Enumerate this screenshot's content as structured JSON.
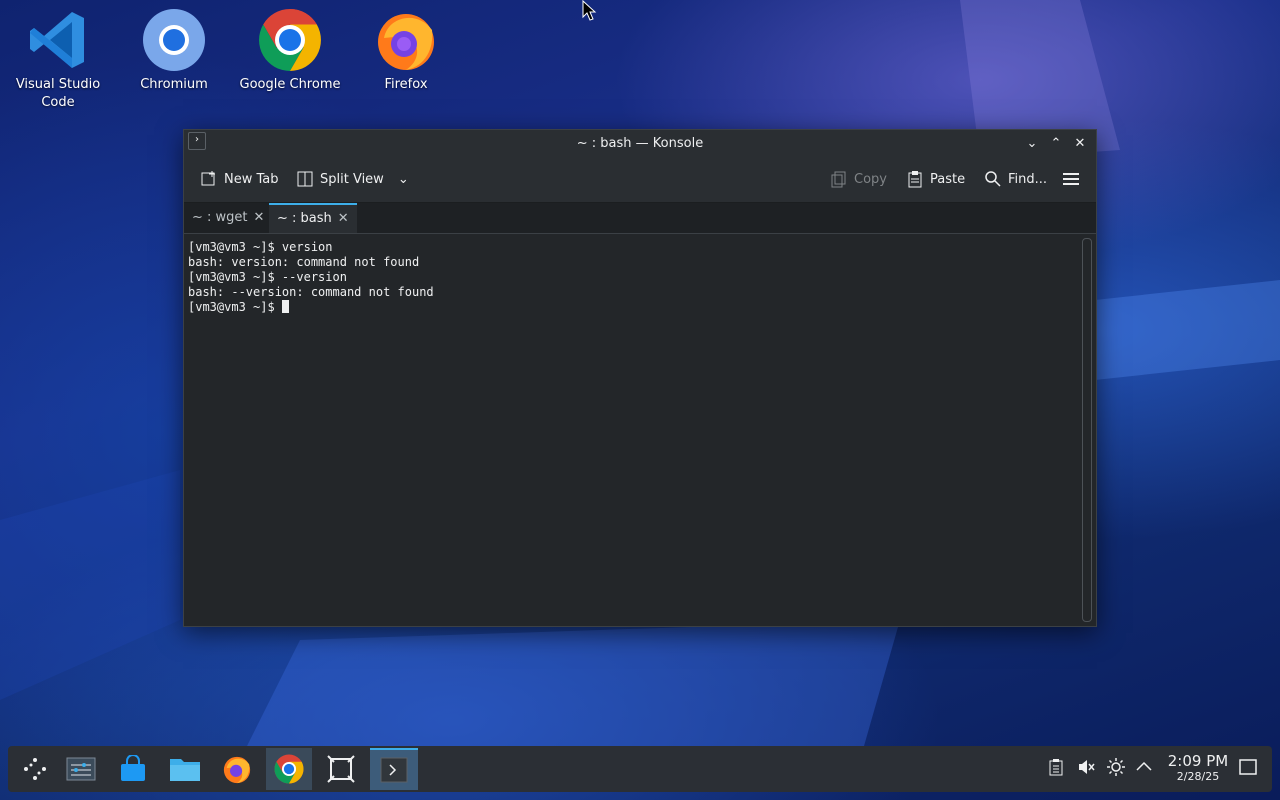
{
  "desktop": {
    "icons": [
      {
        "label": "Visual Studio Code",
        "icon": "vscode-icon"
      },
      {
        "label": "Chromium",
        "icon": "chromium-icon"
      },
      {
        "label": "Google Chrome",
        "icon": "chrome-icon"
      },
      {
        "label": "Firefox",
        "icon": "firefox-icon"
      }
    ]
  },
  "window": {
    "title": "~ : bash — Konsole",
    "toolbar": {
      "new_tab": "New Tab",
      "split_view": "Split View",
      "copy": "Copy",
      "paste": "Paste",
      "find": "Find..."
    },
    "tabs": [
      {
        "label": "~ : wget"
      },
      {
        "label": "~ : bash"
      }
    ],
    "terminal_lines": [
      "[vm3@vm3 ~]$ version",
      "bash: version: command not found",
      "[vm3@vm3 ~]$ --version",
      "bash: --version: command not found",
      "[vm3@vm3 ~]$ "
    ]
  },
  "taskbar": {
    "clock_time": "2:09 PM",
    "clock_date": "2/28/25"
  },
  "colors": {
    "accent": "#3daee9",
    "window_bg": "#232629"
  }
}
